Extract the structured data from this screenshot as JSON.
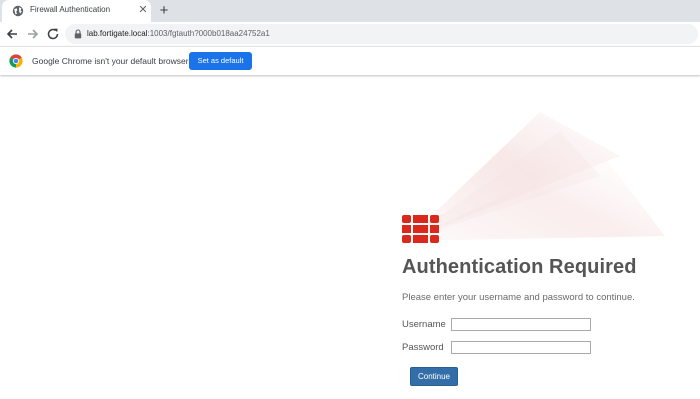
{
  "browser": {
    "tab": {
      "title": "Firewall Authentication",
      "close_glyph": "✕"
    },
    "new_tab_glyph": "+",
    "address_bar": {
      "host": "lab.fortigate.local",
      "path": ":1003/fgtauth?000b018aa24752a1"
    },
    "infobar": {
      "message": "Google Chrome isn't your default browser",
      "button_label": "Set as default"
    },
    "icons": [
      "globe-icon",
      "close-icon",
      "plus-icon",
      "back-arrow-icon",
      "forward-arrow-icon",
      "reload-icon",
      "lock-icon",
      "chrome-logo-icon"
    ]
  },
  "page": {
    "logo": "fortinet-logo-icon",
    "title": "Authentication Required",
    "description": "Please enter your username and password to continue.",
    "username": {
      "label": "Username",
      "value": ""
    },
    "password": {
      "label": "Password",
      "value": ""
    },
    "continue_label": "Continue"
  },
  "colors": {
    "brand_red": "#da291c",
    "button_blue": "#336ea8",
    "chrome_blue": "#1a73e8"
  }
}
